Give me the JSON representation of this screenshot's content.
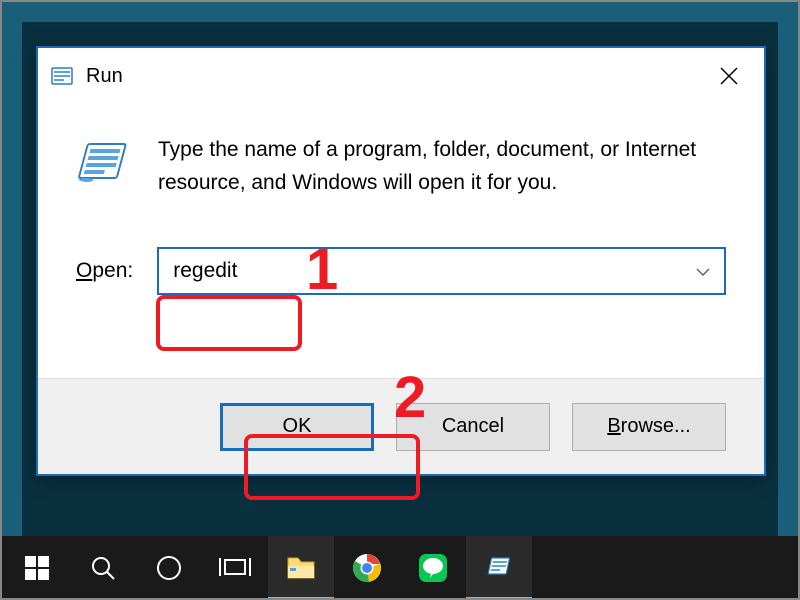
{
  "dialog": {
    "title": "Run",
    "hint": "Type the name of a program, folder, document, or Internet resource, and Windows will open it for you.",
    "open_label": "Open:",
    "input_value": "regedit",
    "buttons": {
      "ok": "OK",
      "cancel": "Cancel",
      "browse": "Browse..."
    }
  },
  "annotations": {
    "step1": "1",
    "step2": "2"
  },
  "colors": {
    "accent": "#1a6bb8",
    "annotation": "#ed1c24"
  }
}
